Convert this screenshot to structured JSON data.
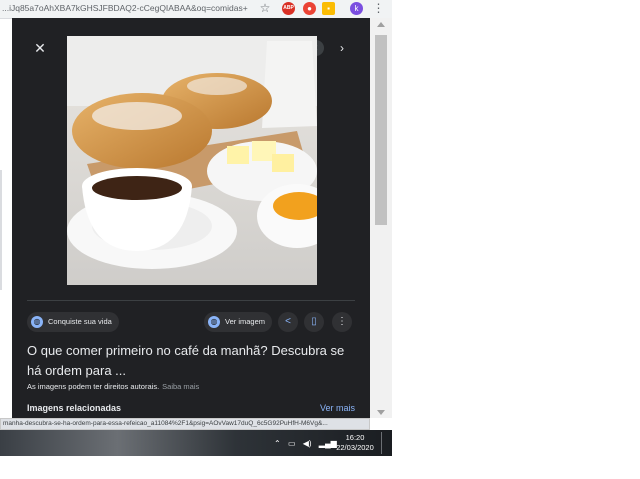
{
  "browser": {
    "url": "...iJq85a7oAhXBA7kGHSJFBDAQ2-cCegQIABAA&oq=comidas+d...",
    "icons": {
      "star": "bookmark-star-icon",
      "abp": "adblock-icon",
      "abp_label": "ABP",
      "shield": "shield-icon",
      "ext": "extension-icon",
      "profile": "profile-avatar",
      "profile_initial": "k",
      "menu": "kebab-menu-icon"
    }
  },
  "viewer": {
    "source_label": "Conquiste sua vida",
    "view_image_label": "Ver imagem",
    "title": "O que comer primeiro no café da manhã? Descubra se há ordem para ...",
    "rights_text": "As imagens podem ter direitos autorais.",
    "learn_more": "Saiba mais",
    "related_heading": "Imagens relacionadas",
    "more_link": "Ver mais"
  },
  "status_url": "manha-descubra-se-ha-ordem-para-essa-refeicao_a11084%2F1&psig=AOvVaw17duQ_6c5G92PuHfH-M6Vg&...",
  "taskbar": {
    "time": "16:20",
    "date": "22/03/2020"
  },
  "colors": {
    "panel_bg": "#202124",
    "link": "#8ab4f8",
    "text": "#e8eaed"
  }
}
